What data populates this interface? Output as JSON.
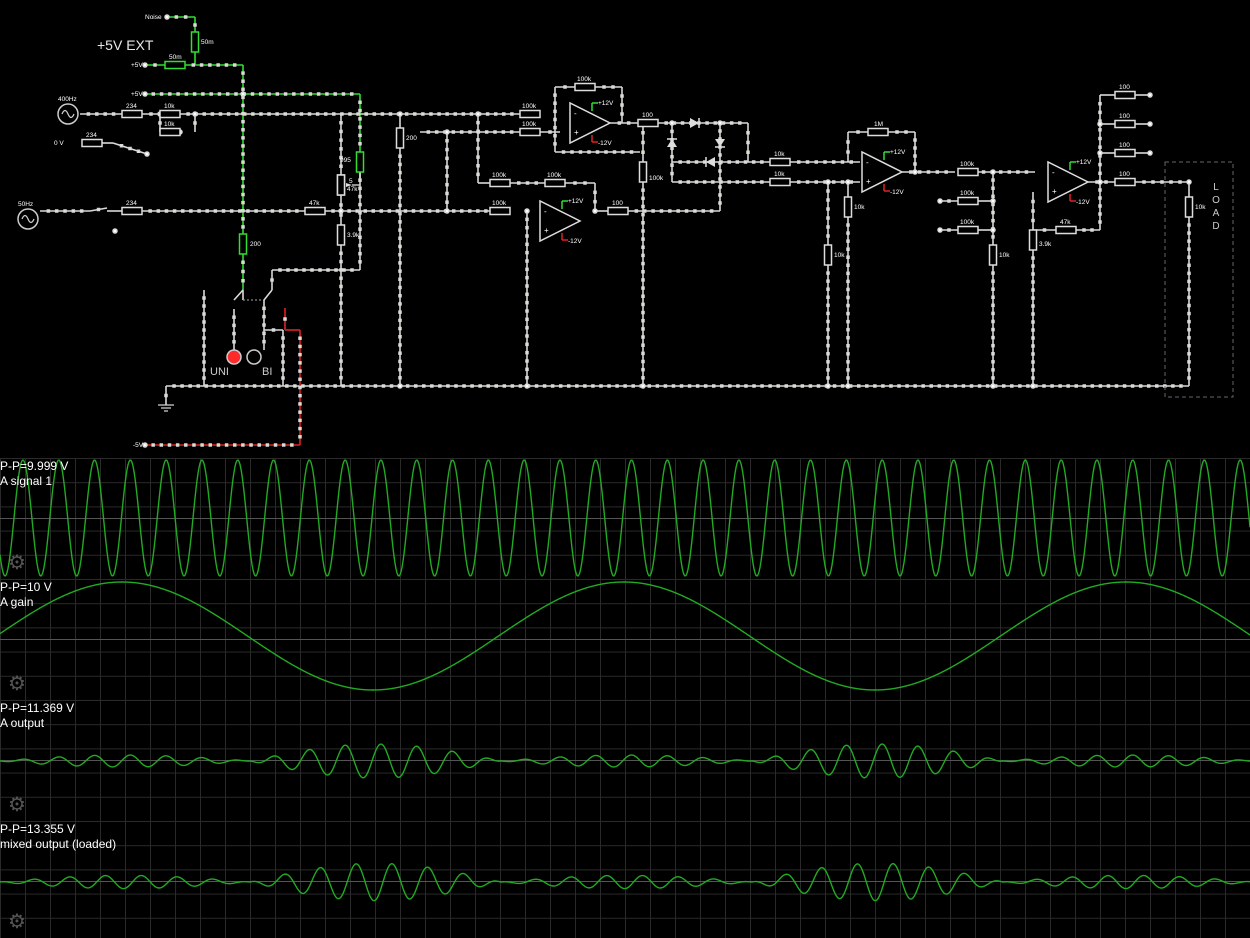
{
  "circuit": {
    "ext_label": "+5V EXT",
    "sources": {
      "noise": "Noise",
      "plus5v_a": "+5V",
      "plus5v_b": "+5V",
      "sig400": "400Hz",
      "zero": "0 V",
      "sig50": "50Hz",
      "minus5v": "-5V"
    },
    "resistors": {
      "r50m_v": "50m",
      "r50m_h": "50m",
      "r234_a": "234",
      "r10k_a": "10k",
      "r10k_b": "10k",
      "r234_b": "234",
      "r234_c": "234",
      "r47k_a": "47k",
      "r995": "995",
      "r5": "5",
      "r47k_pot": "47k",
      "r3k9_a": "3.9k",
      "r200_a": "200",
      "r200_b": "200",
      "r100k_a": "100k",
      "r100k_b": "100k",
      "r100k_fb1": "100k",
      "r100k_c": "100k",
      "r100k_d": "100k",
      "r100k_e": "100k",
      "r100_a": "100",
      "r100_b": "100",
      "r100k_v": "100k",
      "r10k_c": "10k",
      "r10k_d": "10k",
      "r1m": "1M",
      "r10k_e": "10k",
      "r10k_f": "10k",
      "r100k_f": "100k",
      "r100k_g": "100k",
      "r100k_h": "100k",
      "r10k_g": "10k",
      "r47k_b": "47k",
      "r3k9_b": "3.9k",
      "r100_c": "100",
      "r100_d": "100",
      "r100_e": "100",
      "r100_f": "100",
      "r10k_load": "10k"
    },
    "rails": {
      "pos": "+12V",
      "neg": "-12V"
    },
    "switch_labels": {
      "uni": "UNI",
      "bi": "BI"
    },
    "load_label": "LOAD",
    "colors": {
      "wire": "#d9d9d9",
      "live": "#33dd33",
      "negative": "#dd2222",
      "dots": "#ffff55"
    }
  },
  "scopes": [
    {
      "pp": "P-P=9.999 V",
      "name": "A signal 1"
    },
    {
      "pp": "P-P=10 V",
      "name": "A gain"
    },
    {
      "pp": "P-P=11.369 V",
      "name": "A output"
    },
    {
      "pp": "P-P=13.355 V",
      "name": "mixed output (loaded)"
    }
  ],
  "scope_settings_icon": "gear-icon",
  "trace_color": "#22aa22"
}
